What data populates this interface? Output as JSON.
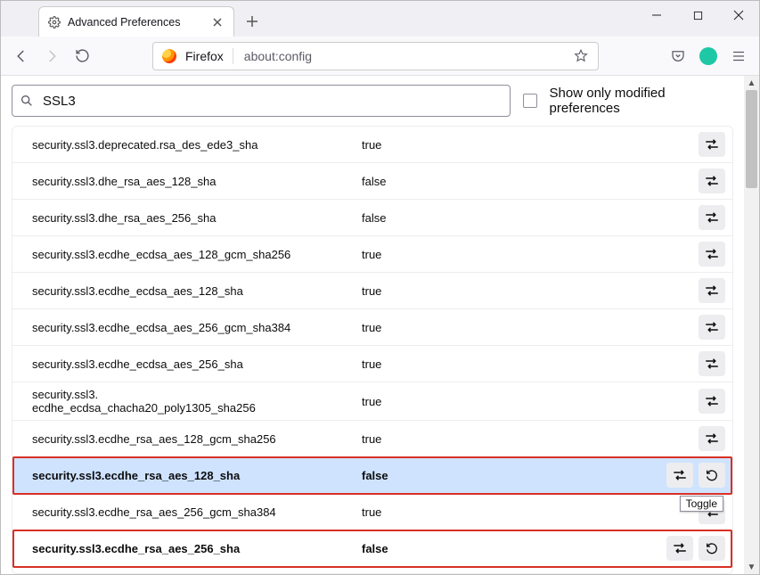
{
  "tab": {
    "title": "Advanced Preferences"
  },
  "identity_label": "Firefox",
  "url": "about:config",
  "search": {
    "value": "SSL3",
    "show_modified_label": "Show only modified preferences"
  },
  "tooltip": "Toggle",
  "prefs": [
    {
      "name": "security.ssl3.deprecated.rsa_des_ede3_sha",
      "value": "true",
      "modified": false,
      "selected": false,
      "reset": false,
      "highlight": false
    },
    {
      "name": "security.ssl3.dhe_rsa_aes_128_sha",
      "value": "false",
      "modified": false,
      "selected": false,
      "reset": false,
      "highlight": false
    },
    {
      "name": "security.ssl3.dhe_rsa_aes_256_sha",
      "value": "false",
      "modified": false,
      "selected": false,
      "reset": false,
      "highlight": false
    },
    {
      "name": "security.ssl3.ecdhe_ecdsa_aes_128_gcm_sha256",
      "value": "true",
      "modified": false,
      "selected": false,
      "reset": false,
      "highlight": false
    },
    {
      "name": "security.ssl3.ecdhe_ecdsa_aes_128_sha",
      "value": "true",
      "modified": false,
      "selected": false,
      "reset": false,
      "highlight": false
    },
    {
      "name": "security.ssl3.ecdhe_ecdsa_aes_256_gcm_sha384",
      "value": "true",
      "modified": false,
      "selected": false,
      "reset": false,
      "highlight": false
    },
    {
      "name": "security.ssl3.ecdhe_ecdsa_aes_256_sha",
      "value": "true",
      "modified": false,
      "selected": false,
      "reset": false,
      "highlight": false
    },
    {
      "name": "security.ssl3.\necdhe_ecdsa_chacha20_poly1305_sha256",
      "value": "true",
      "modified": false,
      "selected": false,
      "reset": false,
      "highlight": false,
      "wrap": true
    },
    {
      "name": "security.ssl3.ecdhe_rsa_aes_128_gcm_sha256",
      "value": "true",
      "modified": false,
      "selected": false,
      "reset": false,
      "highlight": false
    },
    {
      "name": "security.ssl3.ecdhe_rsa_aes_128_sha",
      "value": "false",
      "modified": true,
      "selected": true,
      "reset": true,
      "highlight": true
    },
    {
      "name": "security.ssl3.ecdhe_rsa_aes_256_gcm_sha384",
      "value": "true",
      "modified": false,
      "selected": false,
      "reset": false,
      "highlight": false
    },
    {
      "name": "security.ssl3.ecdhe_rsa_aes_256_sha",
      "value": "false",
      "modified": true,
      "selected": false,
      "reset": true,
      "highlight": true
    }
  ]
}
